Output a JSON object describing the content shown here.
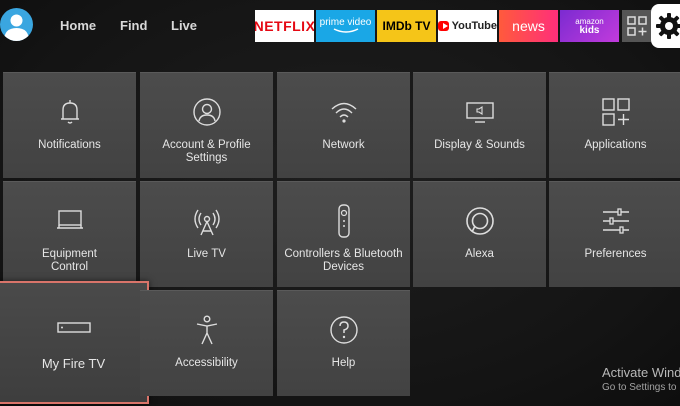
{
  "nav": {
    "home": "Home",
    "find": "Find",
    "live": "Live"
  },
  "apps": {
    "netflix": "NETFLIX",
    "prime_line1": "prime video",
    "imdb": "IMDb TV",
    "youtube": "YouTube",
    "news": "news",
    "kids_line1": "amazon",
    "kids_line2": "kids"
  },
  "tiles": [
    {
      "label": "Notifications",
      "icon": "bell-icon"
    },
    {
      "label": "Account & Profile Settings",
      "icon": "person-icon"
    },
    {
      "label": "Network",
      "icon": "wifi-icon"
    },
    {
      "label": "Display & Sounds",
      "icon": "display-sound-icon"
    },
    {
      "label": "Applications",
      "icon": "apps-grid-icon"
    },
    {
      "label": "Equipment Control",
      "icon": "tv-icon"
    },
    {
      "label": "Live TV",
      "icon": "antenna-icon"
    },
    {
      "label": "Controllers & Bluetooth Devices",
      "icon": "remote-icon"
    },
    {
      "label": "Alexa",
      "icon": "alexa-icon"
    },
    {
      "label": "Preferences",
      "icon": "sliders-icon"
    },
    {
      "label": "My Fire TV",
      "icon": "fire-tv-device-icon"
    },
    {
      "label": "Accessibility",
      "icon": "accessibility-icon"
    },
    {
      "label": "Help",
      "icon": "help-icon"
    }
  ],
  "watermark": {
    "line1": "Activate Wind",
    "line2": "Go to Settings to"
  },
  "colors": {
    "focus_border": "#d9746a",
    "tile_bg": "#474747",
    "settings_bg": "#ffffff"
  }
}
